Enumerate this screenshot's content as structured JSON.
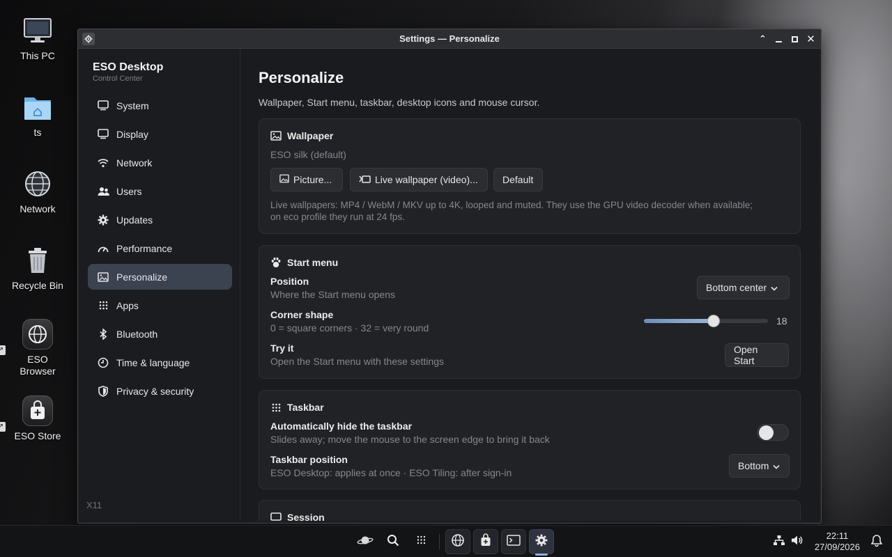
{
  "desktop": {
    "icons": [
      {
        "label": "This PC"
      },
      {
        "label": "ts"
      },
      {
        "label": "Network"
      },
      {
        "label": "Recycle Bin"
      },
      {
        "label": "ESO Browser"
      },
      {
        "label": "ESO Store"
      }
    ]
  },
  "window": {
    "title": "Settings — Personalize",
    "controls": [
      "restore-up",
      "minimize",
      "maximize",
      "close"
    ]
  },
  "sidebar": {
    "brand_name": "ESO Desktop",
    "brand_sub": "Control Center",
    "items": [
      {
        "label": "System",
        "icon": "monitor-icon"
      },
      {
        "label": "Display",
        "icon": "display-icon"
      },
      {
        "label": "Network",
        "icon": "wifi-icon"
      },
      {
        "label": "Users",
        "icon": "users-icon"
      },
      {
        "label": "Updates",
        "icon": "gear-icon"
      },
      {
        "label": "Performance",
        "icon": "gauge-icon"
      },
      {
        "label": "Personalize",
        "icon": "image-icon",
        "active": true
      },
      {
        "label": "Apps",
        "icon": "grid-icon"
      },
      {
        "label": "Bluetooth",
        "icon": "bluetooth-icon"
      },
      {
        "label": "Time & language",
        "icon": "clock-icon"
      },
      {
        "label": "Privacy & security",
        "icon": "shield-icon"
      }
    ],
    "footer": "X11"
  },
  "main": {
    "title": "Personalize",
    "description": "Wallpaper, Start menu, taskbar, desktop icons and mouse cursor.",
    "wallpaper": {
      "heading": "Wallpaper",
      "current": "ESO silk (default)",
      "picture_button": "Picture...",
      "live_button": "Live wallpaper (video)...",
      "default_button": "Default",
      "note_line1": "Live wallpapers: MP4 / WebM / MKV up to 4K, looped and muted. They use the GPU video decoder when available;",
      "note_line2": "on eco profile they run at 24 fps."
    },
    "start_menu": {
      "heading": "Start menu",
      "position_label": "Position",
      "position_sub": "Where the Start menu opens",
      "position_value": "Bottom center",
      "corner_label": "Corner shape",
      "corner_sub": "0 = square corners · 32 = very round",
      "corner_value": "18",
      "corner_min": 0,
      "corner_max": 32,
      "try_label": "Try it",
      "try_sub": "Open the Start menu with these settings",
      "try_button": "Open Start"
    },
    "taskbar": {
      "heading": "Taskbar",
      "autohide_label": "Automatically hide the taskbar",
      "autohide_sub": "Slides away; move the mouse to the screen edge to bring it back",
      "autohide_on": false,
      "position_label": "Taskbar position",
      "position_sub": "ESO Desktop: applies at once · ESO Tiling: after sign-in",
      "position_value": "Bottom"
    },
    "session": {
      "heading": "Session"
    }
  },
  "taskbar_bar": {
    "time": "22:11",
    "date": "27/09/2026"
  },
  "colors": {
    "accent": "#8fb2dc",
    "active_nav": "#3b4250",
    "window_bg": "#1c1d20"
  }
}
